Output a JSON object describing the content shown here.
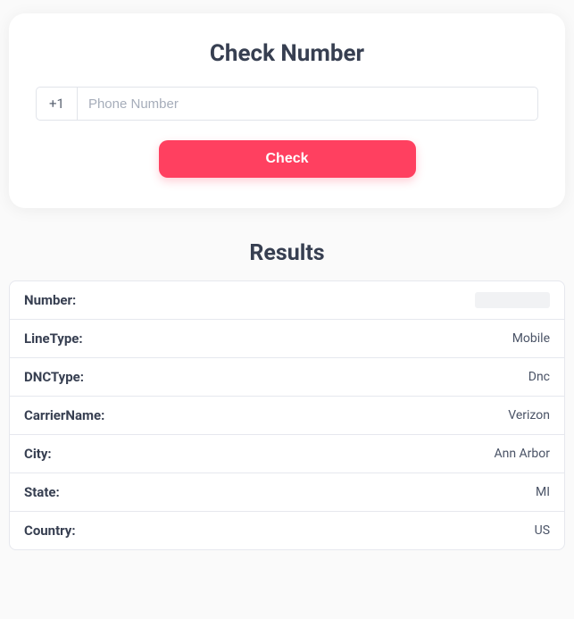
{
  "form": {
    "title": "Check Number",
    "prefix": "+1",
    "placeholder": "Phone Number",
    "value": "",
    "button_label": "Check"
  },
  "results": {
    "title": "Results",
    "rows": [
      {
        "label": "Number:",
        "value": ""
      },
      {
        "label": "LineType:",
        "value": "Mobile"
      },
      {
        "label": "DNCType:",
        "value": "Dnc"
      },
      {
        "label": "CarrierName:",
        "value": "Verizon"
      },
      {
        "label": "City:",
        "value": "Ann Arbor"
      },
      {
        "label": "State:",
        "value": "MI"
      },
      {
        "label": "Country:",
        "value": "US"
      }
    ]
  }
}
